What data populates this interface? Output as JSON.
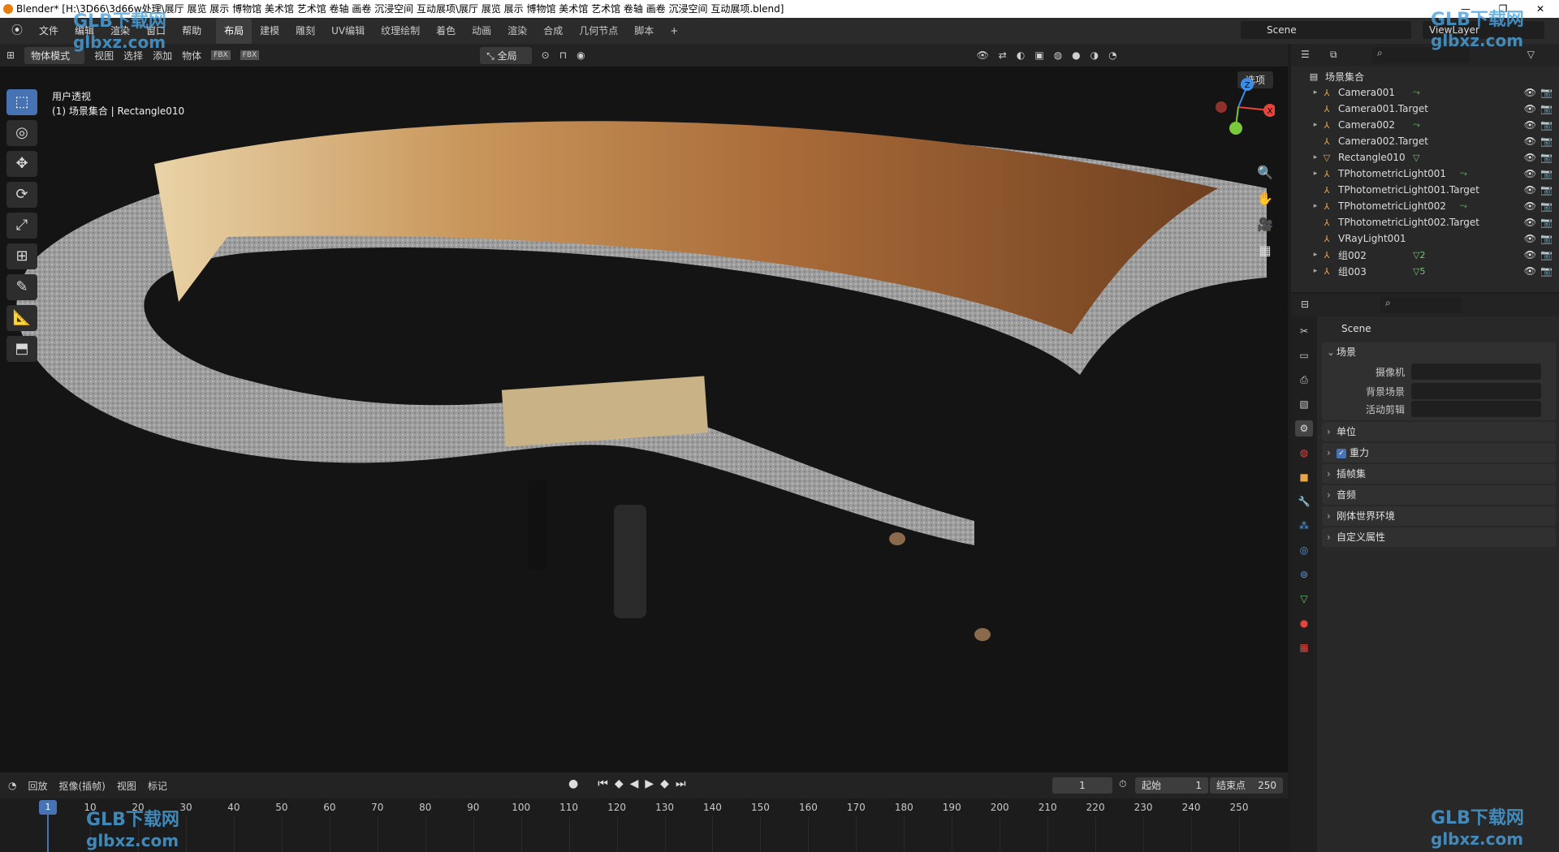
{
  "window": {
    "title": "Blender* [H:\\3D66\\3d66w处理\\展厅 展览 展示 博物馆 美术馆 艺术馆 卷轴 画卷 沉浸空间 互动展项\\展厅 展览 展示 博物馆 美术馆 艺术馆 卷轴 画卷 沉浸空间 互动展项.blend]",
    "controls": [
      "—",
      "❐",
      "✕"
    ]
  },
  "topbar": {
    "menus": [
      "文件",
      "编辑",
      "渲染",
      "窗口",
      "帮助"
    ],
    "workspaces": [
      "布局",
      "建模",
      "雕刻",
      "UV编辑",
      "纹理绘制",
      "着色",
      "动画",
      "渲染",
      "合成",
      "几何节点",
      "脚本",
      "+"
    ],
    "active_workspace": "布局",
    "scene": "Scene",
    "view_layer": "ViewLayer"
  },
  "viewport_header": {
    "mode": "物体模式",
    "menus": [
      "视图",
      "选择",
      "添加",
      "物体"
    ],
    "transform": "全局",
    "options": "选项"
  },
  "viewport": {
    "view_name": "用户透视",
    "context": "(1) 场景集合 | Rectangle010",
    "axes": [
      "Z",
      "X",
      "Y"
    ],
    "tools": [
      "⬚",
      "◎",
      "✥",
      "⟳",
      "⤢",
      "⊞",
      "✎",
      "📐",
      "⬒"
    ]
  },
  "timeline": {
    "menus": [
      "回放",
      "抠像(插帧)",
      "视图",
      "标记"
    ],
    "current_frame": "1",
    "start_label": "起始",
    "start": "1",
    "end_label": "结束点",
    "end": "250",
    "ticks": [
      "1",
      "10",
      "20",
      "30",
      "40",
      "50",
      "60",
      "70",
      "80",
      "90",
      "100",
      "110",
      "120",
      "130",
      "140",
      "150",
      "160",
      "170",
      "180",
      "190",
      "200",
      "210",
      "220",
      "230",
      "240",
      "250"
    ],
    "playback_icons": [
      "⏮",
      "◆",
      "◀",
      "▶",
      "◆",
      "⏭"
    ]
  },
  "outliner": {
    "root": "场景集合",
    "items": [
      {
        "name": "Camera001",
        "expand": "▸",
        "badge": "⤳"
      },
      {
        "name": "Camera001.Target",
        "expand": "",
        "badge": ""
      },
      {
        "name": "Camera002",
        "expand": "▸",
        "badge": "⤳"
      },
      {
        "name": "Camera002.Target",
        "expand": "",
        "badge": ""
      },
      {
        "name": "Rectangle010",
        "expand": "▸",
        "badge": "▽"
      },
      {
        "name": "TPhotometricLight001",
        "expand": "▸",
        "badge": "⤳"
      },
      {
        "name": "TPhotometricLight001.Target",
        "expand": "",
        "badge": ""
      },
      {
        "name": "TPhotometricLight002",
        "expand": "▸",
        "badge": "⤳"
      },
      {
        "name": "TPhotometricLight002.Target",
        "expand": "",
        "badge": ""
      },
      {
        "name": "VRayLight001",
        "expand": "",
        "badge": ""
      },
      {
        "name": "组002",
        "expand": "▸",
        "badge": "▽2"
      },
      {
        "name": "组003",
        "expand": "▸",
        "badge": "▽5"
      }
    ]
  },
  "properties": {
    "scene_name": "Scene",
    "section": "场景",
    "fields": [
      {
        "label": "摄像机"
      },
      {
        "label": "背景场景"
      },
      {
        "label": "活动剪辑"
      }
    ],
    "panels": [
      "单位",
      "重力",
      "插帧集",
      "音频",
      "刚体世界环境",
      "自定义属性"
    ],
    "gravity_checked": "✓"
  },
  "watermark": {
    "brand": "GLB下载网",
    "url": "glbxz.com"
  },
  "colors": {
    "accent": "#4772b3",
    "axis_x": "#e5443c",
    "axis_y": "#7ac93b",
    "axis_z": "#3c8ee5"
  }
}
